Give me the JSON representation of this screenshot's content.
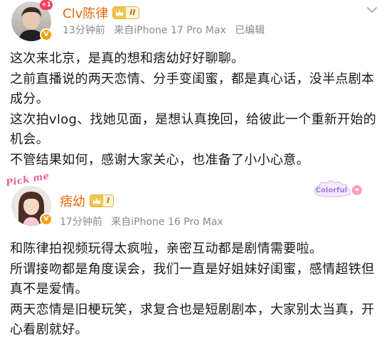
{
  "posts": [
    {
      "username": "Clv陈律",
      "level": "II",
      "notif_badge": "+1",
      "time": "13分钟前",
      "device": "来自iPhone 17 Pro Max",
      "edited": "已编辑",
      "paragraphs": [
        "这次来北京，是真的想和痞幼好好聊聊。",
        "之前直播说的两天恋情、分手变闺蜜，都是真心话，没半点剧本成分。",
        "这次拍vlog、找她见面，是想认真挽回，给彼此一个重新开始的机会。",
        "不管结果如何，感谢大家关心，也准备了小小心意。"
      ]
    },
    {
      "username": "痞幼",
      "level": "I",
      "avatar_overlay": "Pick me",
      "sticker_text": "Colorful",
      "time": "17分钟前",
      "device": "来自iPhone 16 Pro Max",
      "paragraphs": [
        "和陈律拍视频玩得太疯啦，亲密互动都是剧情需要啦。",
        "所谓接吻都是角度误会，我们一直是好姐妹好闺蜜，感情超铁但真不是爱情。",
        "两天恋情是旧梗玩笑，求复合也是短剧剧本，大家别太当真，开心看剧就好。"
      ]
    }
  ],
  "colors": {
    "username": "#e8690b",
    "meta": "#8a8a8a",
    "verify": "#f59e0b",
    "notif": "#f43f5e",
    "level_crown": "#f2c54a"
  },
  "icons": {
    "more": "chevron-down-icon",
    "verify": "verified-v-icon",
    "level": "crown-icon"
  }
}
